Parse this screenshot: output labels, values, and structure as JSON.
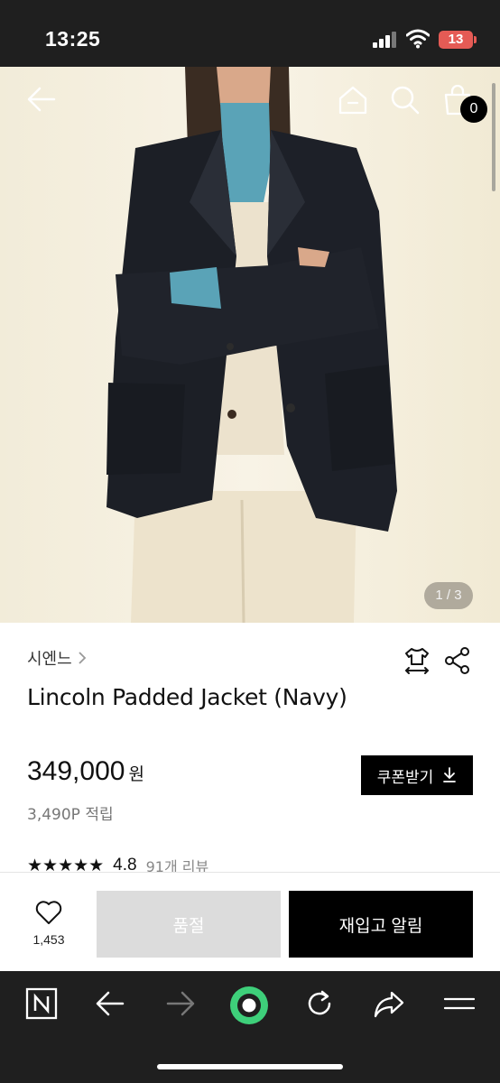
{
  "status_bar": {
    "time": "13:25",
    "battery": "13"
  },
  "hero": {
    "image_counter": "1 / 3",
    "cart_count": "0"
  },
  "product": {
    "brand": "시엔느",
    "name": "Lincoln Padded Jacket (Navy)",
    "price": "349,000",
    "currency": "원",
    "points": "3,490P 적립",
    "coupon_label": "쿠폰받기",
    "rating": "4.8",
    "review_count": "91개 리뷰",
    "stars": "★★★★★"
  },
  "actions": {
    "wish_count": "1,453",
    "soldout_label": "품절",
    "restock_label": "재입고 알림"
  },
  "colors": {
    "accent": "#000000",
    "soldout_bg": "#dcdcdc",
    "browser_bar": "#1f1f1f",
    "record_green": "#3ecf7a"
  },
  "icons": [
    "back-arrow-icon",
    "home-icon",
    "search-icon",
    "cart-icon",
    "size-guide-icon",
    "share-icon",
    "heart-icon",
    "download-icon",
    "naver-icon",
    "nav-back-icon",
    "nav-forward-icon",
    "record-icon",
    "reload-icon",
    "share-forward-icon",
    "menu-icon"
  ]
}
